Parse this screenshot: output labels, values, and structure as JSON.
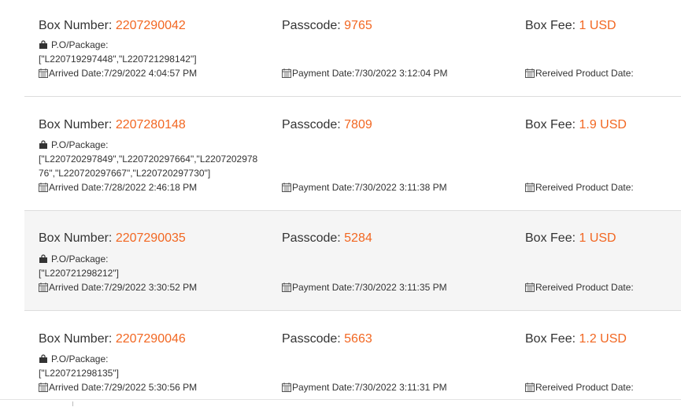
{
  "labels": {
    "box_number": "Box Number: ",
    "passcode": "Passcode: ",
    "box_fee": "Box Fee: ",
    "package": "P.O/Package:",
    "arrived": "Arrived Date: ",
    "payment": "Payment Date: ",
    "received": "Rereived Product Date:"
  },
  "accent_color": "#f26722",
  "icons": {
    "package": "bag-icon",
    "date": "calendar-icon"
  },
  "boxes": [
    {
      "box_number": "2207290042",
      "passcode": "9765",
      "box_fee": "1 USD",
      "packages": "[\"L220719297448\",\"L220721298142\"]",
      "arrived_date": "7/29/2022 4:04:57 PM",
      "payment_date": "7/30/2022 3:12:04 PM",
      "received_date": ""
    },
    {
      "box_number": "2207280148",
      "passcode": "7809",
      "box_fee": "1.9 USD",
      "packages": "[\"L220720297849\",\"L220720297664\",\"L220720297876\",\"L220720297667\",\"L220720297730\"]",
      "arrived_date": "7/28/2022 2:46:18 PM",
      "payment_date": "7/30/2022 3:11:38 PM",
      "received_date": ""
    },
    {
      "box_number": "2207290035",
      "passcode": "5284",
      "box_fee": "1 USD",
      "packages": "[\"L220721298212\"]",
      "arrived_date": "7/29/2022 3:30:52 PM",
      "payment_date": "7/30/2022 3:11:35 PM",
      "received_date": ""
    },
    {
      "box_number": "2207290046",
      "passcode": "5663",
      "box_fee": "1.2 USD",
      "packages": "[\"L220721298135\"]",
      "arrived_date": "7/29/2022 5:30:56 PM",
      "payment_date": "7/30/2022 3:11:31 PM",
      "received_date": ""
    }
  ]
}
